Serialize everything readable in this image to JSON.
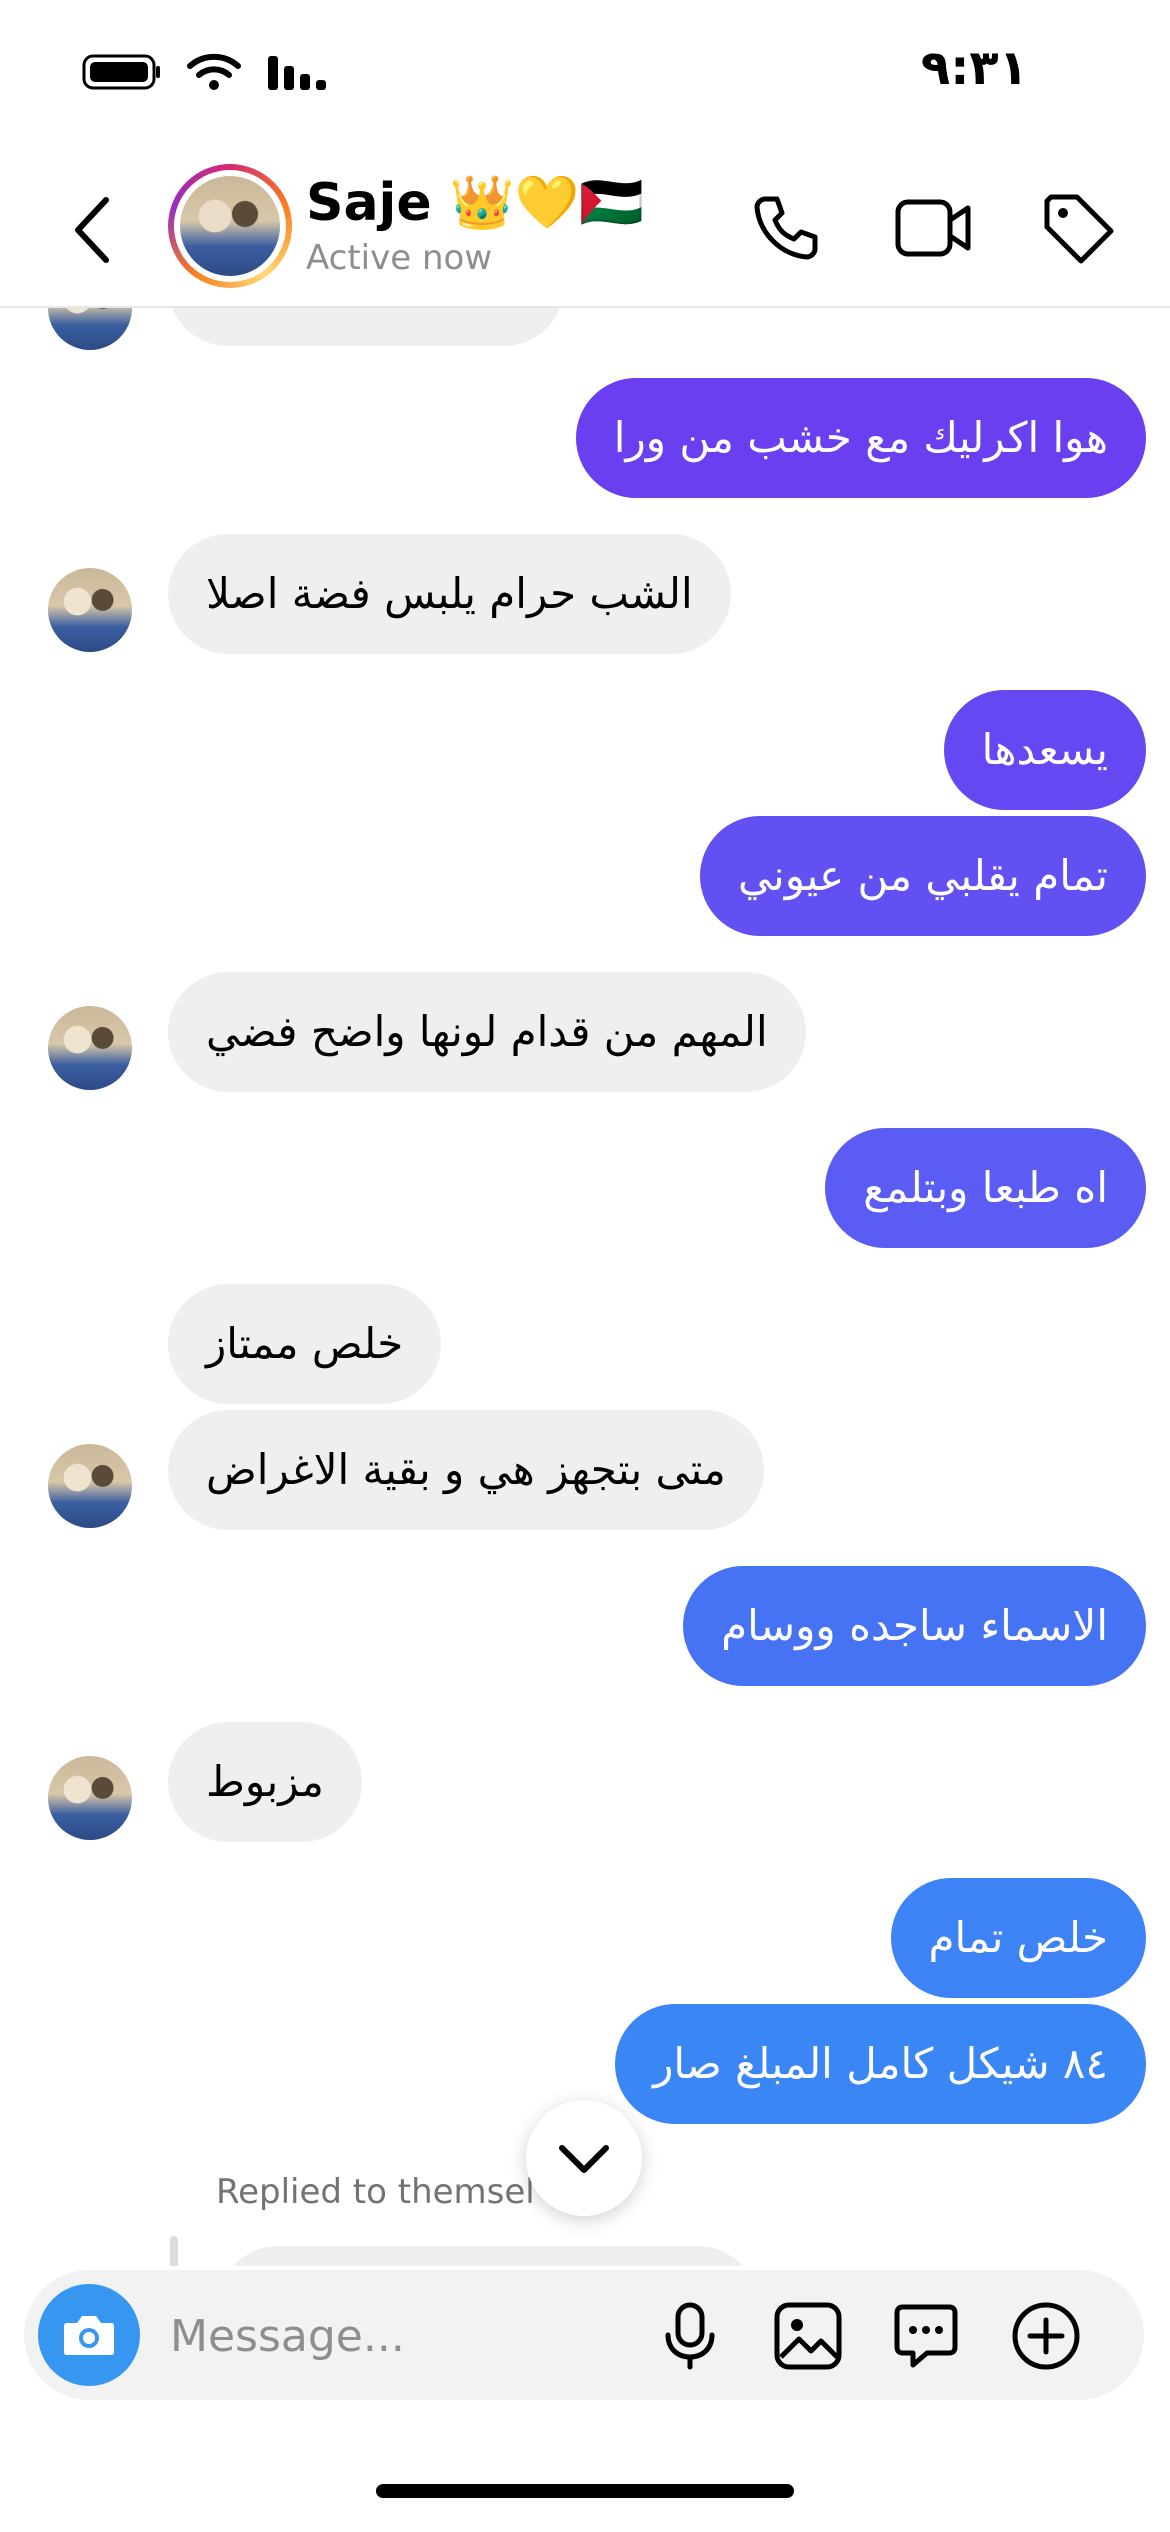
{
  "status_bar": {
    "time": "٩:٣١"
  },
  "header": {
    "name": "Saje 👑💛🇵🇸",
    "status": "Active now",
    "icons": [
      "back-icon",
      "phone-icon",
      "video-icon",
      "tag-icon"
    ]
  },
  "messages": [
    {
      "id": "m1",
      "side": "out",
      "text": "هوا اكرليك مع خشب من ورا",
      "color": "#6a3ff0"
    },
    {
      "id": "m2",
      "side": "in",
      "text": "الشب حرام يلبس فضة اصلا"
    },
    {
      "id": "m3",
      "side": "out",
      "text": "يسعدها",
      "color": "#6648f2"
    },
    {
      "id": "m4",
      "side": "out",
      "text": "تمام يقلبي من عيوني",
      "color": "#6250f2"
    },
    {
      "id": "m5",
      "side": "in",
      "text": "المهم من قدام لونها واضح فضي"
    },
    {
      "id": "m6",
      "side": "out",
      "text": "اه طبعا وبتلمع",
      "color": "#5a5cf3"
    },
    {
      "id": "m7",
      "side": "in",
      "text": "خلص ممتاز"
    },
    {
      "id": "m8",
      "side": "in",
      "text": "متى بتجهز هي و بقية الاغراض"
    },
    {
      "id": "m9",
      "side": "out",
      "text": "الاسماء ساجده ووسام",
      "color": "#4673f4"
    },
    {
      "id": "m10",
      "side": "in",
      "text": "مزبوط"
    },
    {
      "id": "m11",
      "side": "out",
      "text": "خلص تمام",
      "color": "#3d83f5"
    },
    {
      "id": "m12",
      "side": "out",
      "text": "٨٤ شيكل كامل المبلغ صار",
      "color": "#3b86f5"
    }
  ],
  "replied_label": "Replied to themsel",
  "composer": {
    "placeholder": "Message..."
  },
  "colors": {
    "incoming": "#efefef",
    "accent_camera": "#3797f0"
  }
}
